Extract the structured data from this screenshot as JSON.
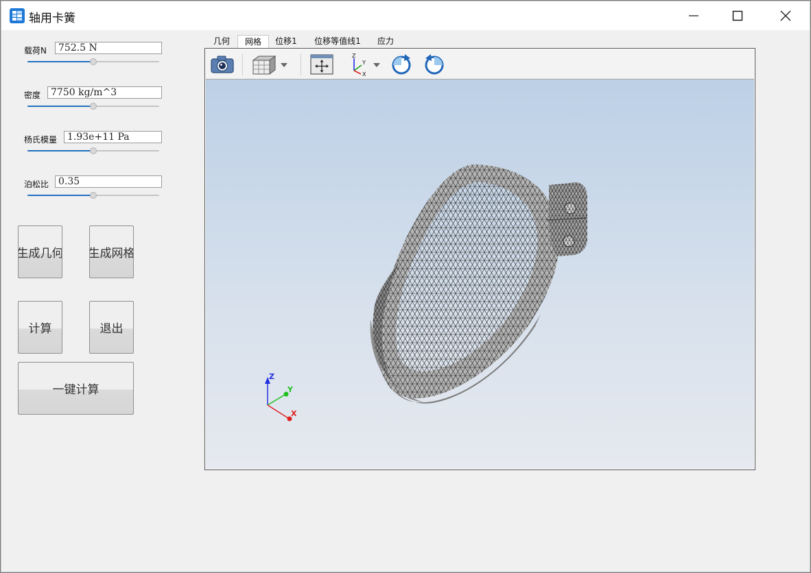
{
  "window": {
    "title": "轴用卡簧"
  },
  "params": [
    {
      "label": "载荷N",
      "value": "752.5 N",
      "slider": 0.5
    },
    {
      "label": "密度",
      "value": "7750 kg/m^3",
      "slider": 0.5
    },
    {
      "label": "杨氏模量",
      "value": "1.93e+11 Pa",
      "slider": 0.5
    },
    {
      "label": "泊松比",
      "value": "0.35",
      "slider": 0.5
    }
  ],
  "buttons": {
    "gen_geometry": "生成几何",
    "gen_mesh": "生成网格",
    "compute": "计算",
    "exit": "退出",
    "one_click": "一键计算"
  },
  "tabs": [
    "几何",
    "网格",
    "位移1",
    "位移等值线1",
    "应力"
  ],
  "active_tab": "网格",
  "toolbar": [
    "camera-icon",
    "cube-view-icon",
    "fit-view-icon",
    "axes-orientation-icon",
    "rotate-clockwise-icon",
    "rotate-counterclockwise-icon"
  ],
  "axes": {
    "x": "X",
    "y": "Y",
    "z": "Z"
  },
  "colors": {
    "accent": "#1f6fc0",
    "axis_x": "#e02020",
    "axis_y": "#20c020",
    "axis_z": "#2030e0"
  }
}
